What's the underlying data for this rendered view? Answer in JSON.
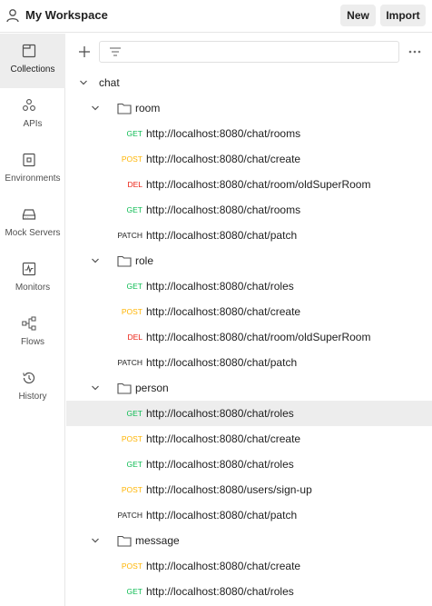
{
  "header": {
    "title": "My Workspace",
    "new_label": "New",
    "import_label": "Import"
  },
  "sidebar": {
    "items": [
      {
        "label": "Collections",
        "icon": "collections-icon",
        "active": true
      },
      {
        "label": "APIs",
        "icon": "apis-icon"
      },
      {
        "label": "Environments",
        "icon": "environments-icon"
      },
      {
        "label": "Mock Servers",
        "icon": "mock-servers-icon"
      },
      {
        "label": "Monitors",
        "icon": "monitors-icon"
      },
      {
        "label": "Flows",
        "icon": "flows-icon"
      },
      {
        "label": "History",
        "icon": "history-icon"
      }
    ]
  },
  "colors": {
    "GET": "#0cbb52",
    "POST": "#ffb400",
    "DEL": "#eb2013",
    "PATCH": "#212121"
  },
  "tree": {
    "collection": "chat",
    "rows": [
      {
        "type": "folder",
        "label": "room"
      },
      {
        "type": "request",
        "method": "GET",
        "url": "http://localhost:8080/chat/rooms"
      },
      {
        "type": "request",
        "method": "POST",
        "url": "http://localhost:8080/chat/create"
      },
      {
        "type": "request",
        "method": "DEL",
        "url": "http://localhost:8080/chat/room/oldSuperRoom"
      },
      {
        "type": "request",
        "method": "GET",
        "url": "http://localhost:8080/chat/rooms"
      },
      {
        "type": "request",
        "method": "PATCH",
        "url": "http://localhost:8080/chat/patch"
      },
      {
        "type": "folder",
        "label": "role"
      },
      {
        "type": "request",
        "method": "GET",
        "url": "http://localhost:8080/chat/roles"
      },
      {
        "type": "request",
        "method": "POST",
        "url": "http://localhost:8080/chat/create"
      },
      {
        "type": "request",
        "method": "DEL",
        "url": "http://localhost:8080/chat/room/oldSuperRoom"
      },
      {
        "type": "request",
        "method": "PATCH",
        "url": "http://localhost:8080/chat/patch"
      },
      {
        "type": "folder",
        "label": "person"
      },
      {
        "type": "request",
        "method": "GET",
        "url": "http://localhost:8080/chat/roles",
        "selected": true
      },
      {
        "type": "request",
        "method": "POST",
        "url": "http://localhost:8080/chat/create"
      },
      {
        "type": "request",
        "method": "GET",
        "url": "http://localhost:8080/chat/roles"
      },
      {
        "type": "request",
        "method": "POST",
        "url": "http://localhost:8080/users/sign-up"
      },
      {
        "type": "request",
        "method": "PATCH",
        "url": "http://localhost:8080/chat/patch"
      },
      {
        "type": "folder",
        "label": "message"
      },
      {
        "type": "request",
        "method": "POST",
        "url": "http://localhost:8080/chat/create"
      },
      {
        "type": "request",
        "method": "GET",
        "url": "http://localhost:8080/chat/roles"
      }
    ]
  }
}
